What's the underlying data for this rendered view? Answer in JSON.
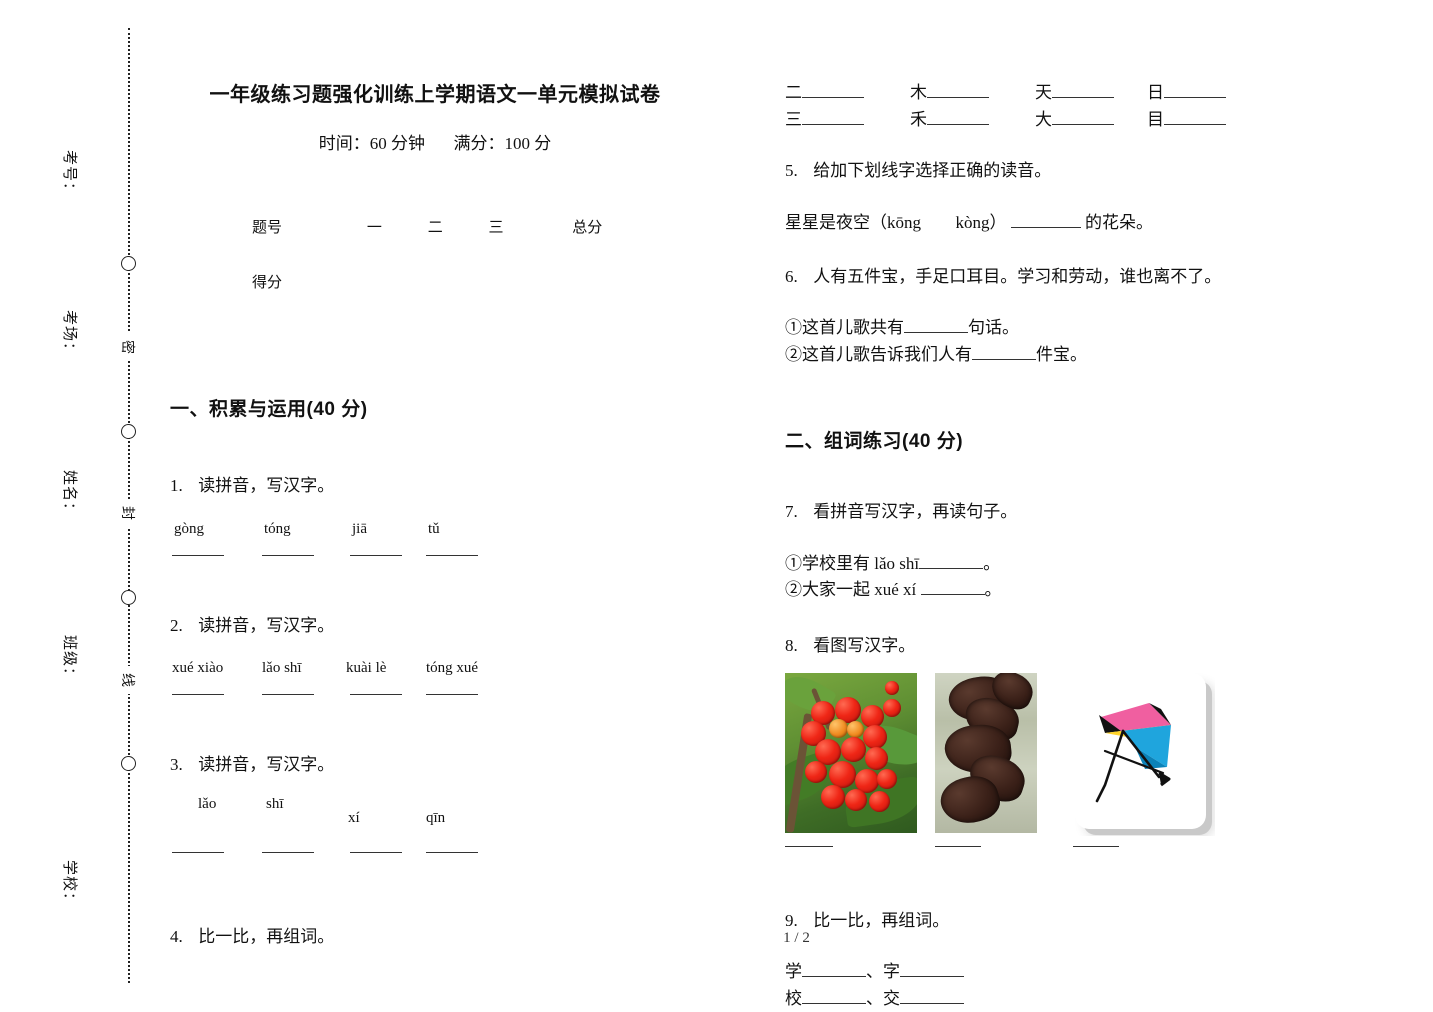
{
  "seal_margin": {
    "labels": [
      "考号：",
      "考场：",
      "姓名：",
      "班级：",
      "学校："
    ],
    "seal_chars": [
      "密",
      "封",
      "线"
    ]
  },
  "header": {
    "title": "一年级练习题强化训练上学期语文一单元模拟试卷",
    "time_label": "时间：60 分钟",
    "score_label": "满分：100 分"
  },
  "score_table": {
    "row_label_1": "题号",
    "row_label_2": "得分",
    "columns": [
      "一",
      "二",
      "三",
      "总分"
    ]
  },
  "sections": [
    {
      "id": "s1",
      "heading": "一、积累与运用(40 分)"
    },
    {
      "id": "s2",
      "heading": "二、组词练习(40 分)"
    }
  ],
  "questions": {
    "q1": {
      "num": "1.",
      "text": "读拼音，写汉字。",
      "pinyin": [
        "gòng",
        "tóng",
        "jiā",
        "tǔ"
      ]
    },
    "q2": {
      "num": "2.",
      "text": "读拼音，写汉字。",
      "pinyin": [
        "xué xiào",
        "lǎo shī",
        "kuài lè",
        "tóng xué"
      ]
    },
    "q3": {
      "num": "3.",
      "text": "读拼音，写汉字。",
      "pinyin": [
        "lǎo",
        "shī",
        "xí",
        "qīn"
      ]
    },
    "q4": {
      "num": "4.",
      "text": "比一比，再组词。",
      "pairs_row1": [
        "二",
        "木",
        "天",
        "日"
      ],
      "pairs_row2": [
        "三",
        "禾",
        "大",
        "目"
      ]
    },
    "q5": {
      "num": "5.",
      "text": "给加下划线字选择正确的读音。",
      "sentence_a": "星星是夜空（kōng",
      "sentence_b": "kòng）",
      "sentence_c": "的花朵。"
    },
    "q6": {
      "num": "6.",
      "text": "人有五件宝，手足口耳目。学习和劳动，谁也离不了。",
      "sub1_a": "①这首儿歌共有",
      "sub1_b": "句话。",
      "sub2_a": "②这首儿歌告诉我们人有",
      "sub2_b": "件宝。"
    },
    "q7": {
      "num": "7.",
      "text": "看拼音写汉字，再读句子。",
      "sub1_a": "①学校里有 lǎo shī",
      "sub1_b": "。",
      "sub2_a": "②大家一起 xué xí ",
      "sub2_b": "。"
    },
    "q8": {
      "num": "8.",
      "text": "看图写汉字。",
      "images": [
        {
          "name": "red-berries-photo",
          "alt": "红果"
        },
        {
          "name": "wood-ear-fungus-photo",
          "alt": "木耳"
        },
        {
          "name": "kite-photo",
          "alt": "风筝"
        }
      ]
    },
    "q9": {
      "num": "9.",
      "text": "比一比，再组词。",
      "row1": [
        "学",
        "字"
      ],
      "row2": [
        "校",
        "交"
      ],
      "separator": "、"
    }
  },
  "footer": {
    "page_indicator": "1 / 2"
  },
  "colors": {
    "text": "#111111",
    "rule": "#333333",
    "berry_red": "#ef2616",
    "leaf_green": "#4c8a2c",
    "kite_blue": "#1fa5dd",
    "kite_yellow": "#ffd42a",
    "kite_pink": "#f05fa0"
  }
}
